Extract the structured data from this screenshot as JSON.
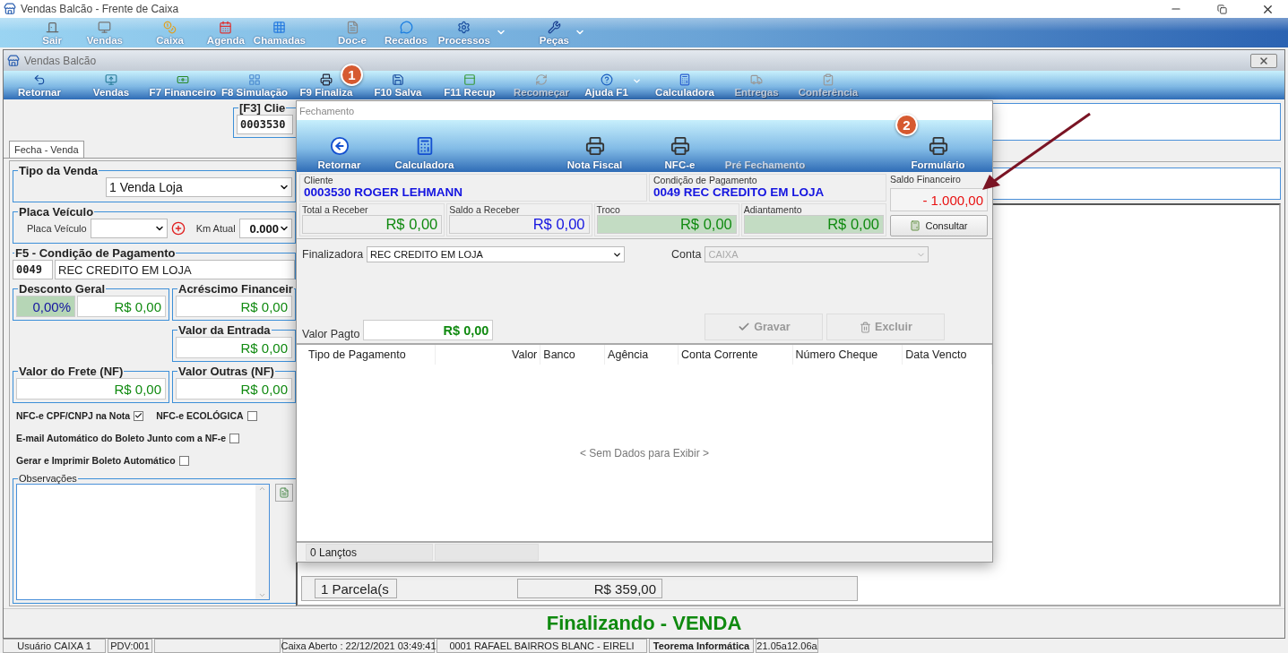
{
  "window": {
    "title": "Vendas Balcão - Frente de Caixa"
  },
  "main_toolbar": [
    {
      "label": "Sair",
      "has_menu": false
    },
    {
      "label": "Vendas",
      "has_menu": false
    },
    {
      "label": "Caixa",
      "has_menu": false
    },
    {
      "label": "Agenda",
      "has_menu": false
    },
    {
      "label": "Chamadas",
      "has_menu": false
    },
    {
      "label": "Doc-e",
      "has_menu": false
    },
    {
      "label": "Recados",
      "has_menu": false
    },
    {
      "label": "Processos",
      "has_menu": true
    },
    {
      "label": "Peças",
      "has_menu": true
    }
  ],
  "child_window": {
    "title": "Vendas Balcão"
  },
  "child_toolbar": [
    {
      "label": "Retornar",
      "disabled": false,
      "has_menu": false
    },
    {
      "label": "Vendas",
      "disabled": false,
      "has_menu": false
    },
    {
      "label": "F7 Financeiro",
      "disabled": false,
      "has_menu": false
    },
    {
      "label": "F8 Simulação",
      "disabled": false,
      "has_menu": false
    },
    {
      "label": "F9 Finaliza",
      "disabled": false,
      "has_menu": false
    },
    {
      "label": "F10 Salva",
      "disabled": false,
      "has_menu": false
    },
    {
      "label": "F11 Recup",
      "disabled": false,
      "has_menu": false
    },
    {
      "label": "Recomeçar",
      "disabled": true,
      "has_menu": false
    },
    {
      "label": "Ajuda F1",
      "disabled": false,
      "has_menu": true
    },
    {
      "label": "Calculadora",
      "disabled": false,
      "has_menu": false
    },
    {
      "label": "Entregas",
      "disabled": true,
      "has_menu": false
    },
    {
      "label": "Conferência",
      "disabled": true,
      "has_menu": false
    }
  ],
  "client_box": {
    "label": "[F3] Clie",
    "code": "0003530"
  },
  "tabs": [
    {
      "label": "Fecha - Venda",
      "selected": true
    }
  ],
  "form": {
    "tipo_venda": {
      "label": "Tipo da Venda",
      "value": "1 Venda Loja"
    },
    "placa": {
      "label": "Placa Veículo",
      "field_label": "Placa Veículo",
      "km_label": "Km Atual",
      "km_value": "0.000"
    },
    "condicao": {
      "label": "F5 - Condição de Pagamento",
      "code": "0049",
      "name": "REC CREDITO EM LOJA"
    },
    "desconto": {
      "label": "Desconto Geral",
      "percent": "0,00%",
      "value": "R$ 0,00"
    },
    "acrescimo": {
      "label": "Acréscimo Financeir",
      "value": "R$ 0,00"
    },
    "entrada": {
      "label": "Valor da Entrada",
      "value": "R$ 0,00"
    },
    "frete": {
      "label": "Valor do Frete (NF)",
      "value": "R$ 0,00"
    },
    "outras": {
      "label": "Valor Outras (NF)",
      "value": "R$ 0,00"
    },
    "options": [
      {
        "label": "NFC-e CPF/CNPJ na Nota",
        "checked": true
      },
      {
        "label": "NFC-e ECOLÓGICA",
        "checked": false
      },
      {
        "label": "E-mail Automático do Boleto Junto com a NF-e",
        "checked": false
      },
      {
        "label": "Gerar e Imprimir Boleto Automático",
        "checked": false
      }
    ],
    "observacoes": {
      "label": "Observações"
    }
  },
  "parcelas": {
    "count": "1 Parcela(s",
    "total": "R$ 359,00"
  },
  "footer_status": "Finalizando - VENDA",
  "status_bar": [
    {
      "text": "Usuário CAIXA 1",
      "bold": false
    },
    {
      "text": "PDV:001",
      "bold": false
    },
    {
      "text": "Caixa Aberto : 22/12/2021 03:49:41",
      "bold": false
    },
    {
      "text": "0001 RAFAEL BAIRROS BLANC - EIRELI",
      "bold": false
    },
    {
      "text": "Teorema Informática",
      "bold": true
    },
    {
      "text": "21.05a12.06a",
      "bold": false
    }
  ],
  "dialog": {
    "title": "Fechamento",
    "toolbar": [
      {
        "label": "Retornar",
        "disabled": false
      },
      {
        "label": "Calculadora",
        "disabled": false
      },
      {
        "label": "Nota Fiscal",
        "disabled": false
      },
      {
        "label": "NFC-e",
        "disabled": false
      },
      {
        "label": "Pré Fechamento",
        "disabled": true
      },
      {
        "label": "Formulário",
        "disabled": false
      }
    ],
    "cliente": {
      "label": "Cliente",
      "value": "0003530 ROGER LEHMANN"
    },
    "condicao": {
      "label": "Condição de Pagamento",
      "value": "0049 REC CREDITO EM LOJA"
    },
    "saldo": {
      "label": "Saldo Financeiro",
      "value": "- 1.000,00",
      "button": "Consultar"
    },
    "totals": [
      {
        "label": "Total a Receber",
        "value": "R$ 0,00",
        "color": "#108a10",
        "shaded": false
      },
      {
        "label": "Saldo a Receber",
        "value": "R$ 0,00",
        "color": "#1414e0",
        "shaded": false
      },
      {
        "label": "Troco",
        "value": "R$ 0,00",
        "color": "#108a10",
        "shaded": true
      },
      {
        "label": "Adiantamento",
        "value": "R$ 0,00",
        "color": "#108a10",
        "shaded": true
      }
    ],
    "finalizadora": {
      "label": "Finalizadora",
      "value": "REC CREDITO EM LOJA"
    },
    "conta": {
      "label": "Conta",
      "value": "CAIXA",
      "disabled": true
    },
    "valor_pagto": {
      "label": "Valor Pagto",
      "value": "R$ 0,00"
    },
    "buttons": [
      {
        "label": "Gravar",
        "disabled": true
      },
      {
        "label": "Excluir",
        "disabled": true
      }
    ],
    "table": {
      "columns": [
        "Tipo de Pagamento",
        "Valor",
        "Banco",
        "Agência",
        "Conta Corrente",
        "Número Cheque",
        "Data Vencto"
      ],
      "empty_text": "< Sem Dados para Exibir >"
    },
    "footer": "0 Lançtos"
  },
  "annotations": [
    {
      "label": "1"
    },
    {
      "label": "2"
    }
  ]
}
